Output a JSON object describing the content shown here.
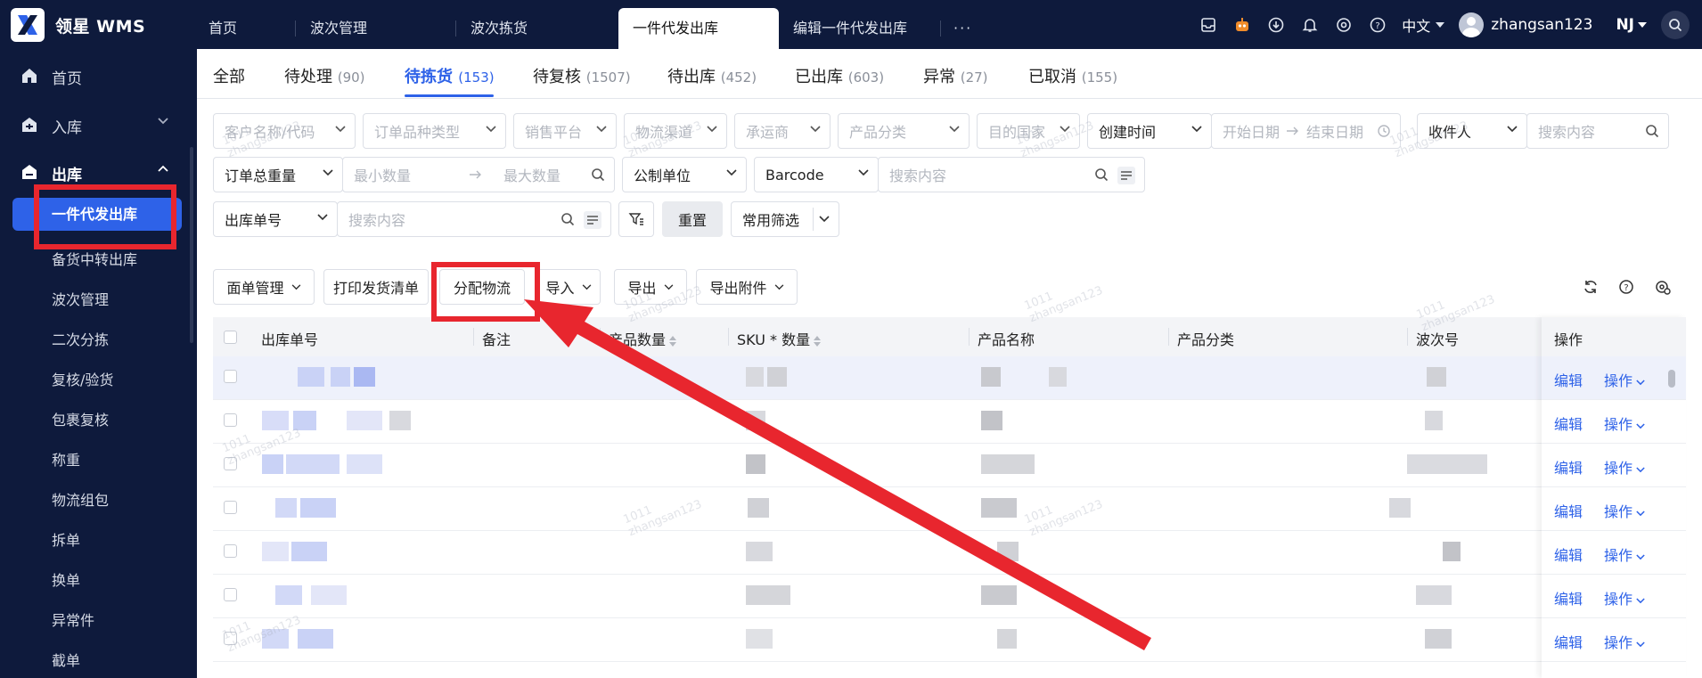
{
  "app": {
    "brand": "领星 WMS"
  },
  "top_tabs": [
    {
      "label": "首页"
    },
    {
      "label": "波次管理"
    },
    {
      "label": "波次拣货"
    },
    {
      "label": "一件代发出库",
      "active": true
    },
    {
      "label": "编辑一件代发出库"
    },
    {
      "label": "···"
    }
  ],
  "top_right": {
    "language": "中文",
    "username": "zhangsan123",
    "warehouse": "NJ"
  },
  "sidebar": {
    "menus": [
      {
        "label": "首页",
        "icon": "home-icon"
      },
      {
        "label": "入库",
        "icon": "inbound-icon"
      },
      {
        "label": "出库",
        "icon": "outbound-icon"
      }
    ],
    "outbound_items": [
      {
        "label": "一件代发出库",
        "active": true
      },
      {
        "label": "备货中转出库"
      },
      {
        "label": "波次管理"
      },
      {
        "label": "二次分拣"
      },
      {
        "label": "复核/验货"
      },
      {
        "label": "包裹复核"
      },
      {
        "label": "称重"
      },
      {
        "label": "物流组包"
      },
      {
        "label": "拆单"
      },
      {
        "label": "换单"
      },
      {
        "label": "异常件"
      },
      {
        "label": "截单"
      }
    ]
  },
  "status_tabs": [
    {
      "label": "全部",
      "count": ""
    },
    {
      "label": "待处理",
      "count": "(90)"
    },
    {
      "label": "待拣货",
      "count": "(153)",
      "active": true
    },
    {
      "label": "待复核",
      "count": "(1507)"
    },
    {
      "label": "待出库",
      "count": "(452)"
    },
    {
      "label": "已出库",
      "count": "(603)"
    },
    {
      "label": "异常",
      "count": "(27)"
    },
    {
      "label": "已取消",
      "count": "(155)"
    }
  ],
  "filters": {
    "customer": "客户名称/代码",
    "order_type": "订单品种类型",
    "platform": "销售平台",
    "channel": "物流渠道",
    "carrier": "承运商",
    "category": "产品分类",
    "country": "目的国家",
    "time_field": "创建时间",
    "start_date": "开始日期",
    "end_date": "结束日期",
    "receiver_field": "收件人",
    "receiver_placeholder": "搜索内容",
    "weight_field": "订单总重量",
    "min_qty": "最小数量",
    "max_qty": "最大数量",
    "unit": "公制单位",
    "barcode_field": "Barcode",
    "barcode_placeholder": "搜索内容",
    "order_no_field": "出库单号",
    "order_no_placeholder": "搜索内容",
    "reset": "重置",
    "common_filter": "常用筛选"
  },
  "toolbar": {
    "waybill": "面单管理",
    "print_list": "打印发货清单",
    "assign_logistics": "分配物流",
    "import": "导入",
    "export": "导出",
    "export_attachments": "导出附件"
  },
  "table": {
    "headers": {
      "order_no": "出库单号",
      "remark": "备注",
      "product_qty": "产品数量",
      "sku_qty": "SKU * 数量",
      "product_name": "产品名称",
      "product_category": "产品分类",
      "wave_no": "波次号",
      "ops": "操作"
    },
    "row_actions": {
      "edit": "编辑",
      "more": "操作"
    },
    "row_count": 7
  },
  "watermark": {
    "line1": "1011",
    "line2": "zhangsan123"
  },
  "colors": {
    "primary": "#2e62e8",
    "nav_bg": "#0e1a3c",
    "annotation": "#e8262e"
  }
}
